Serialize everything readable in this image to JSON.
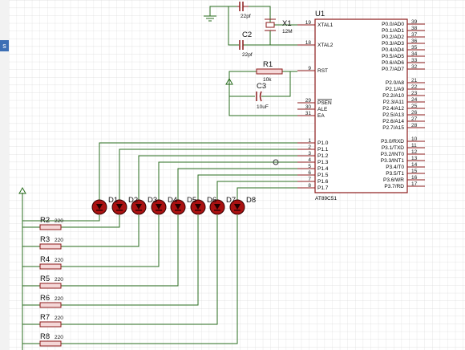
{
  "ui": {
    "left_tab_label": "s"
  },
  "colors": {
    "wire": "#2a6e1f",
    "component": "#8b1a1a",
    "chip_fill": "#ffffff",
    "grid": "#d9d9d9",
    "led_fill": "#aa1111"
  },
  "mcu": {
    "ref": "U1",
    "part": "AT89C51",
    "left_pins": [
      {
        "num": "19",
        "name": "XTAL1"
      },
      {
        "num": "18",
        "name": "XTAL2"
      },
      {
        "num": "9",
        "name": "RST"
      },
      {
        "num": "29",
        "name": "PSEN"
      },
      {
        "num": "30",
        "name": "ALE"
      },
      {
        "num": "31",
        "name": "EA"
      },
      {
        "num": "1",
        "name": "P1.0"
      },
      {
        "num": "2",
        "name": "P1.1"
      },
      {
        "num": "3",
        "name": "P1.2"
      },
      {
        "num": "4",
        "name": "P1.3"
      },
      {
        "num": "5",
        "name": "P1.4"
      },
      {
        "num": "6",
        "name": "P1.5"
      },
      {
        "num": "7",
        "name": "P1.6"
      },
      {
        "num": "8",
        "name": "P1.7"
      }
    ],
    "right_pins": [
      {
        "num": "39",
        "name": "P0.0/AD0"
      },
      {
        "num": "38",
        "name": "P0.1/AD1"
      },
      {
        "num": "37",
        "name": "P0.2/AD2"
      },
      {
        "num": "36",
        "name": "P0.3/AD3"
      },
      {
        "num": "35",
        "name": "P0.4/AD4"
      },
      {
        "num": "34",
        "name": "P0.5/AD5"
      },
      {
        "num": "33",
        "name": "P0.6/AD6"
      },
      {
        "num": "32",
        "name": "P0.7/AD7"
      },
      {
        "num": "21",
        "name": "P2.0/A8"
      },
      {
        "num": "22",
        "name": "P2.1/A9"
      },
      {
        "num": "23",
        "name": "P2.2/A10"
      },
      {
        "num": "24",
        "name": "P2.3/A11"
      },
      {
        "num": "25",
        "name": "P2.4/A12"
      },
      {
        "num": "26",
        "name": "P2.5/A13"
      },
      {
        "num": "27",
        "name": "P2.6/A14"
      },
      {
        "num": "28",
        "name": "P2.7/A15"
      },
      {
        "num": "10",
        "name": "P3.0/RXD"
      },
      {
        "num": "11",
        "name": "P3.1/TXD"
      },
      {
        "num": "12",
        "name": "P3.2/INT0"
      },
      {
        "num": "13",
        "name": "P3.3/INT1"
      },
      {
        "num": "14",
        "name": "P3.4/T0"
      },
      {
        "num": "15",
        "name": "P3.5/T1"
      },
      {
        "num": "16",
        "name": "P3.6/WR"
      },
      {
        "num": "17",
        "name": "P3.7/RD"
      }
    ]
  },
  "oscillator": {
    "c1_value": "22pf",
    "c2_ref": "C2",
    "c2_value": "22pf",
    "crystal_ref": "X1",
    "crystal_value": "12M"
  },
  "reset": {
    "r_ref": "R1",
    "r_value": "10k",
    "c_ref": "C3",
    "c_value": "10uF"
  },
  "leds": [
    "D1",
    "D2",
    "D3",
    "D4",
    "D5",
    "D6",
    "D7",
    "D8"
  ],
  "resistors": [
    {
      "ref": "R2",
      "value": "220"
    },
    {
      "ref": "R3",
      "value": "220"
    },
    {
      "ref": "R4",
      "value": "220"
    },
    {
      "ref": "R5",
      "value": "220"
    },
    {
      "ref": "R6",
      "value": "220"
    },
    {
      "ref": "R7",
      "value": "220"
    },
    {
      "ref": "R8",
      "value": "220"
    }
  ]
}
